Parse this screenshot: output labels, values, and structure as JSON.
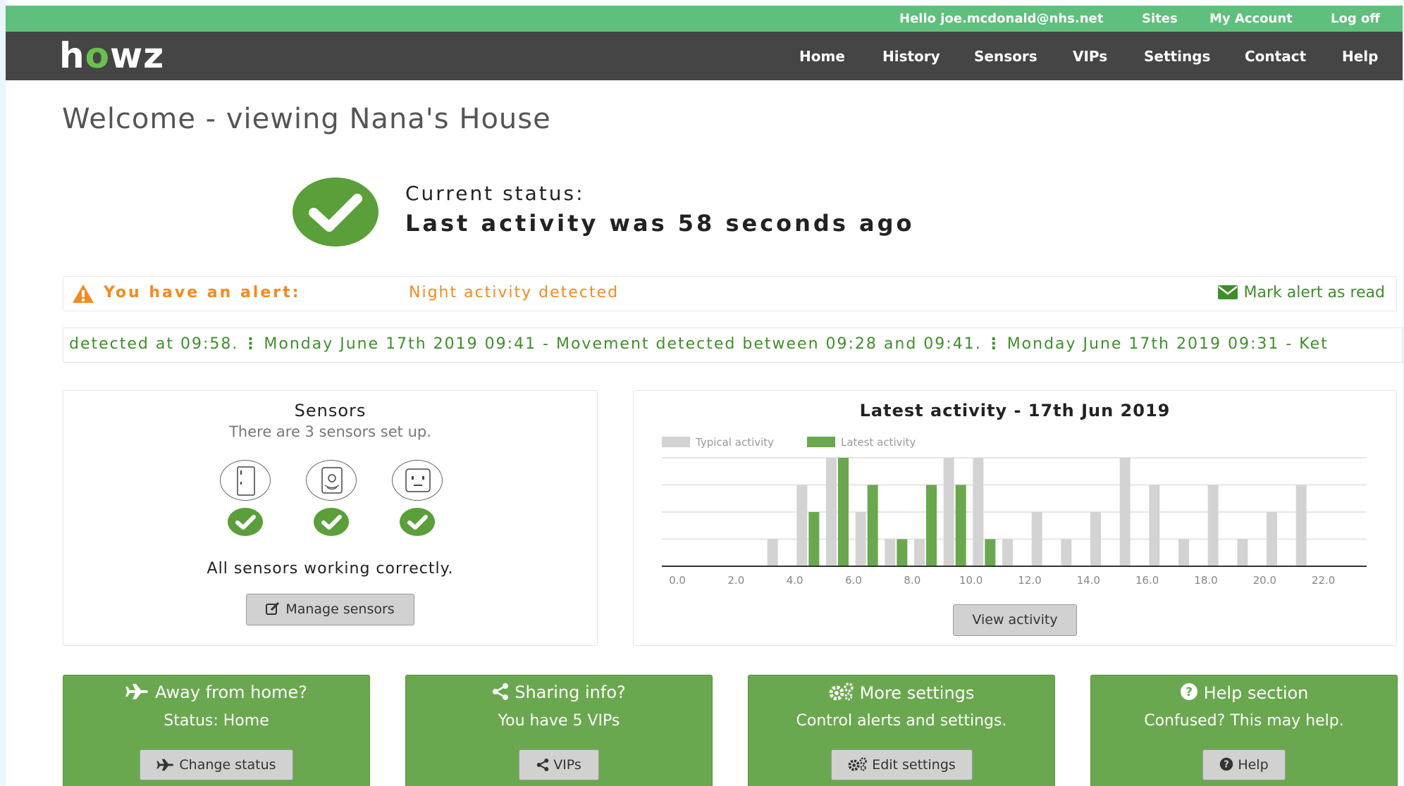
{
  "topbar": {
    "greeting": "Hello joe.mcdonald@nhs.net",
    "links": [
      "Sites",
      "My Account",
      "Log off"
    ]
  },
  "nav": {
    "logo": "howz",
    "items": [
      "Home",
      "History",
      "Sensors",
      "VIPs",
      "Settings",
      "Contact",
      "Help"
    ]
  },
  "page": {
    "title": "Welcome - viewing Nana's House"
  },
  "status": {
    "label": "Current status:",
    "text": "Last activity was 58 seconds ago"
  },
  "alert": {
    "label": "You have an alert:",
    "message": "Night activity detected",
    "action": "Mark alert as read"
  },
  "ticker": {
    "items": [
      "detected at 09:58.",
      "Monday June 17th 2019 09:41 - Movement detected between 09:28 and 09:41.",
      "Monday June 17th 2019 09:31 - Ket"
    ]
  },
  "sensors": {
    "title": "Sensors",
    "subtitle": "There are 3 sensors set up.",
    "icons": [
      "door-sensor-icon",
      "motion-sensor-icon",
      "plug-sensor-icon"
    ],
    "status_text": "All sensors working correctly.",
    "manage_label": "Manage sensors"
  },
  "activity": {
    "view_label": "View activity"
  },
  "tiles": [
    {
      "icon": "plane-icon",
      "title": "Away from home?",
      "subtitle": "Status: Home",
      "button": "Change status"
    },
    {
      "icon": "share-icon",
      "title": "Sharing info?",
      "subtitle": "You have 5 VIPs",
      "button": "VIPs"
    },
    {
      "icon": "gears-icon",
      "title": "More settings",
      "subtitle": "Control alerts and settings.",
      "button": "Edit settings"
    },
    {
      "icon": "question-icon",
      "title": "Help section",
      "subtitle": "Confused? This may help.",
      "button": "Help"
    }
  ],
  "colors": {
    "topbar": "#5fbf7c",
    "navbar": "#454545",
    "accent_green": "#6aa84f",
    "status_green": "#5a9f3a",
    "alert_orange": "#f58a1f",
    "typical_bar": "#d3d3d3",
    "latest_bar": "#6aa84f"
  },
  "chart_data": {
    "type": "bar",
    "title": "Latest activity - 17th Jun 2019",
    "xlabel": "",
    "ylabel": "",
    "x_ticks": [
      "0.0",
      "2.0",
      "4.0",
      "6.0",
      "8.0",
      "10.0",
      "12.0",
      "14.0",
      "16.0",
      "18.0",
      "20.0",
      "22.0"
    ],
    "xlim": [
      0,
      24
    ],
    "ylim": [
      0,
      4
    ],
    "grid": true,
    "legend": "top-left",
    "x": [
      4,
      5,
      6,
      7,
      8,
      9,
      10,
      11,
      12,
      13,
      14,
      15,
      16,
      17,
      18,
      19,
      20,
      21,
      22
    ],
    "series": [
      {
        "name": "Typical activity",
        "color": "#d3d3d3",
        "values": [
          1,
          3,
          4,
          2,
          1,
          1,
          4,
          4,
          1,
          2,
          1,
          2,
          4,
          3,
          1,
          3,
          1,
          2,
          3
        ]
      },
      {
        "name": "Latest activity",
        "color": "#6aa84f",
        "values": [
          0,
          2,
          4,
          3,
          1,
          3,
          3,
          1,
          0,
          0,
          0,
          0,
          0,
          0,
          0,
          0,
          0,
          0,
          0
        ]
      }
    ]
  }
}
